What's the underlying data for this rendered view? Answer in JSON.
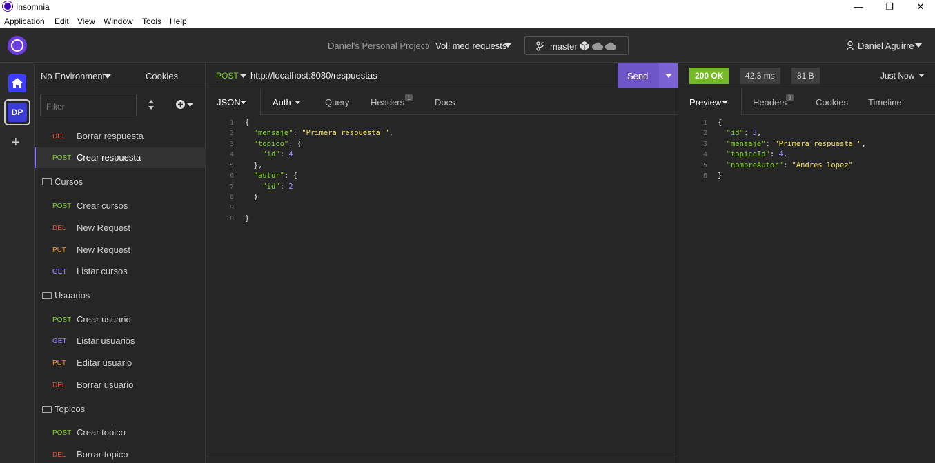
{
  "window": {
    "title": "Insomnia",
    "controls": {
      "minimize": "—",
      "maximize": "❐",
      "close": "✕"
    }
  },
  "menu": [
    "Application",
    "Edit",
    "View",
    "Window",
    "Tools",
    "Help"
  ],
  "header": {
    "project": "Daniel's Personal Project",
    "separator": "/",
    "collection": "Voll med requests",
    "branch": "master",
    "user": "Daniel Aguirre"
  },
  "rail": {
    "workspace_initials": "DP",
    "add": "+"
  },
  "sidebar": {
    "environment": "No Environment",
    "cookies": "Cookies",
    "filter_placeholder": "Filter",
    "items": [
      {
        "kind": "request",
        "method": "DEL",
        "name": "Borrar respuesta"
      },
      {
        "kind": "request",
        "method": "POST",
        "name": "Crear respuesta",
        "active": true
      },
      {
        "kind": "folder",
        "name": "Cursos"
      },
      {
        "kind": "request",
        "method": "POST",
        "name": "Crear cursos"
      },
      {
        "kind": "request",
        "method": "DEL",
        "name": "New Request"
      },
      {
        "kind": "request",
        "method": "PUT",
        "name": "New Request"
      },
      {
        "kind": "request",
        "method": "GET",
        "name": "Listar cursos"
      },
      {
        "kind": "folder",
        "name": "Usuarios"
      },
      {
        "kind": "request",
        "method": "POST",
        "name": "Crear usuario"
      },
      {
        "kind": "request",
        "method": "GET",
        "name": "Listar usuarios"
      },
      {
        "kind": "request",
        "method": "PUT",
        "name": "Editar usuario"
      },
      {
        "kind": "request",
        "method": "DEL",
        "name": "Borrar usuario"
      },
      {
        "kind": "folder",
        "name": "Topicos"
      },
      {
        "kind": "request",
        "method": "POST",
        "name": "Crear topico"
      },
      {
        "kind": "request",
        "method": "DEL",
        "name": "Borrar topico"
      }
    ]
  },
  "request": {
    "method": "POST",
    "url": "http://localhost:8080/respuestas",
    "send_label": "Send",
    "tabs": {
      "body": "JSON",
      "auth": "Auth",
      "query": "Query",
      "headers": "Headers",
      "headers_count": "1",
      "docs": "Docs"
    },
    "body_lines": [
      "{",
      "  \"mensaje\": \"Primera respuesta \",",
      "  \"topico\": {",
      "    \"id\": 4",
      "  },",
      "  \"autor\": {",
      "    \"id\": 2",
      "  }",
      "",
      "}"
    ]
  },
  "response": {
    "status": "200 OK",
    "time": "42.3 ms",
    "size": "81 B",
    "when": "Just Now",
    "tabs": {
      "preview": "Preview",
      "headers": "Headers",
      "headers_count": "3",
      "cookies": "Cookies",
      "timeline": "Timeline"
    },
    "body_lines": [
      "{",
      "  \"id\": 3,",
      "  \"mensaje\": \"Primera respuesta \",",
      "  \"topicoId\": 4,",
      "  \"nombreAutor\": \"Andres lopez\"",
      "}"
    ]
  },
  "colors": {
    "accent": "#6e56c8",
    "status_ok": "#75ba24",
    "method_del": "#e5533d",
    "method_post": "#7ed321",
    "method_put": "#ff9a1f",
    "method_get": "#a288ff"
  }
}
